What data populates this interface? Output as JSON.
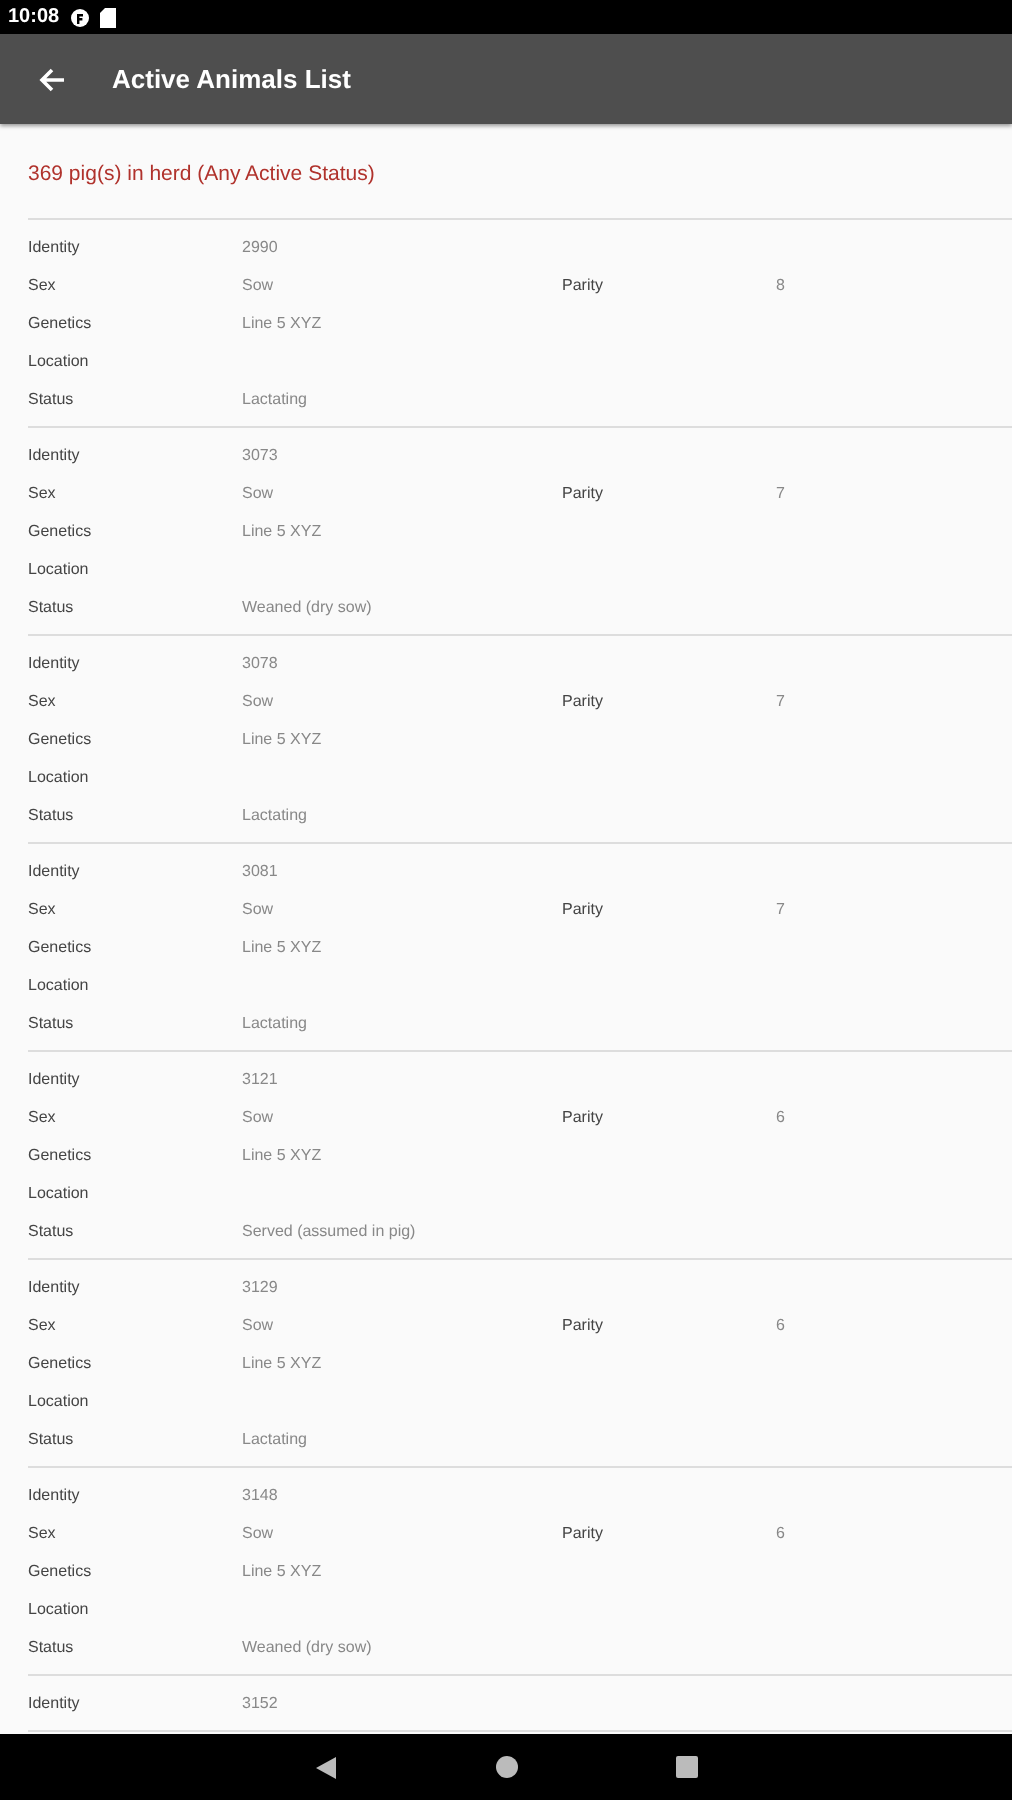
{
  "status_bar": {
    "time": "10:08"
  },
  "app_bar": {
    "title": "Active Animals List"
  },
  "summary": "369 pig(s) in herd (Any Active Status)",
  "records": [
    {
      "rows": [
        {
          "label": "Identity",
          "value": "2990"
        },
        {
          "label": "Sex",
          "value": "Sow",
          "extra_label": "Parity",
          "extra_value": "8"
        },
        {
          "label": "Genetics",
          "value": "Line 5 XYZ"
        },
        {
          "label": "Location"
        },
        {
          "label": "Status",
          "value": "Lactating"
        }
      ]
    },
    {
      "rows": [
        {
          "label": "Identity",
          "value": "3073"
        },
        {
          "label": "Sex",
          "value": "Sow",
          "extra_label": "Parity",
          "extra_value": "7"
        },
        {
          "label": "Genetics",
          "value": "Line 5 XYZ"
        },
        {
          "label": "Location"
        },
        {
          "label": "Status",
          "value": "Weaned (dry sow)"
        }
      ]
    },
    {
      "rows": [
        {
          "label": "Identity",
          "value": "3078"
        },
        {
          "label": "Sex",
          "value": "Sow",
          "extra_label": "Parity",
          "extra_value": "7"
        },
        {
          "label": "Genetics",
          "value": "Line 5 XYZ"
        },
        {
          "label": "Location"
        },
        {
          "label": "Status",
          "value": "Lactating"
        }
      ]
    },
    {
      "rows": [
        {
          "label": "Identity",
          "value": "3081"
        },
        {
          "label": "Sex",
          "value": "Sow",
          "extra_label": "Parity",
          "extra_value": "7"
        },
        {
          "label": "Genetics",
          "value": "Line 5 XYZ"
        },
        {
          "label": "Location"
        },
        {
          "label": "Status",
          "value": "Lactating"
        }
      ]
    },
    {
      "rows": [
        {
          "label": "Identity",
          "value": "3121"
        },
        {
          "label": "Sex",
          "value": "Sow",
          "extra_label": "Parity",
          "extra_value": "6"
        },
        {
          "label": "Genetics",
          "value": "Line 5 XYZ"
        },
        {
          "label": "Location"
        },
        {
          "label": "Status",
          "value": "Served (assumed in pig)"
        }
      ]
    },
    {
      "rows": [
        {
          "label": "Identity",
          "value": "3129"
        },
        {
          "label": "Sex",
          "value": "Sow",
          "extra_label": "Parity",
          "extra_value": "6"
        },
        {
          "label": "Genetics",
          "value": "Line 5 XYZ"
        },
        {
          "label": "Location"
        },
        {
          "label": "Status",
          "value": "Lactating"
        }
      ]
    },
    {
      "rows": [
        {
          "label": "Identity",
          "value": "3148"
        },
        {
          "label": "Sex",
          "value": "Sow",
          "extra_label": "Parity",
          "extra_value": "6"
        },
        {
          "label": "Genetics",
          "value": "Line 5 XYZ"
        },
        {
          "label": "Location"
        },
        {
          "label": "Status",
          "value": "Weaned (dry sow)"
        }
      ]
    },
    {
      "rows": [
        {
          "label": "Identity",
          "value": "3152"
        }
      ]
    }
  ]
}
